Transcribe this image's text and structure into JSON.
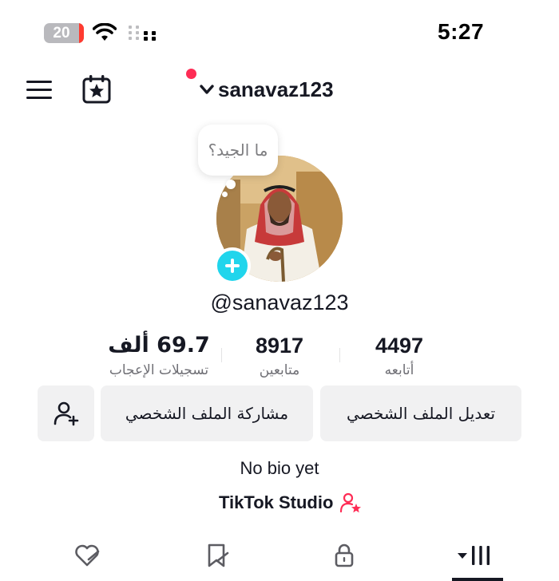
{
  "status_bar": {
    "battery_level": "20",
    "time": "5:27",
    "icons": [
      "battery-icon",
      "wifi-icon",
      "signal-icon"
    ]
  },
  "header": {
    "username": "sanavaz123",
    "icons": [
      "menu-icon",
      "calendar-star-icon",
      "chevron-down-icon"
    ],
    "notification_color": "#fe2c55"
  },
  "profile": {
    "note": "ما الجيد؟",
    "handle": "@sanavaz123",
    "avatar_add_color": "#20d5ec"
  },
  "stats": {
    "following": {
      "value": "4497",
      "label": "أتابعه"
    },
    "followers": {
      "value": "8917",
      "label": "متابعين"
    },
    "likes": {
      "value": "69.7 ألف",
      "label": "تسجيلات الإعجاب"
    }
  },
  "actions": {
    "edit_profile": "تعديل الملف الشخصي",
    "share_profile": "مشاركة الملف الشخصي",
    "add_friend_icon": "add-user-icon"
  },
  "bio": "No bio yet",
  "studio": {
    "label": "TikTok Studio",
    "icon": "user-star-icon",
    "icon_color": "#fe2c55"
  },
  "tabs": [
    {
      "name": "videos",
      "icon": "grid-icon"
    },
    {
      "name": "private",
      "icon": "lock-icon"
    },
    {
      "name": "favorites",
      "icon": "bookmark-icon"
    },
    {
      "name": "liked",
      "icon": "heart-icon"
    }
  ],
  "selected_tab": "videos"
}
